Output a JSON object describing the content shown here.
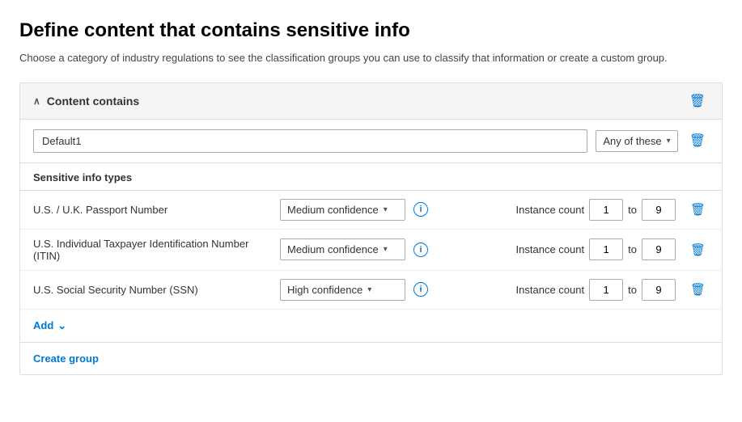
{
  "page": {
    "title": "Define content that contains sensitive info",
    "subtitle": "Choose a category of industry regulations to see the classification groups you can use to classify that information or create a custom group."
  },
  "card": {
    "header_label": "Content contains",
    "group_name": "Default1",
    "any_of_label": "Any of these",
    "any_of_chevron": "▾",
    "section_title": "Sensitive info types",
    "info_rows": [
      {
        "name": "U.S. / U.K. Passport Number",
        "confidence": "Medium confidence",
        "instance_count_from": "1",
        "instance_count_to": "9"
      },
      {
        "name": "U.S. Individual Taxpayer Identification Number (ITIN)",
        "confidence": "Medium confidence",
        "instance_count_from": "1",
        "instance_count_to": "9"
      },
      {
        "name": "U.S. Social Security Number (SSN)",
        "confidence": "High confidence",
        "instance_count_from": "1",
        "instance_count_to": "9"
      }
    ],
    "add_label": "Add",
    "create_group_label": "Create group"
  },
  "icons": {
    "chevron_up": "∧",
    "chevron_down": "⌄",
    "trash": "🗑",
    "info": "i",
    "add_chevron": "⌄"
  }
}
